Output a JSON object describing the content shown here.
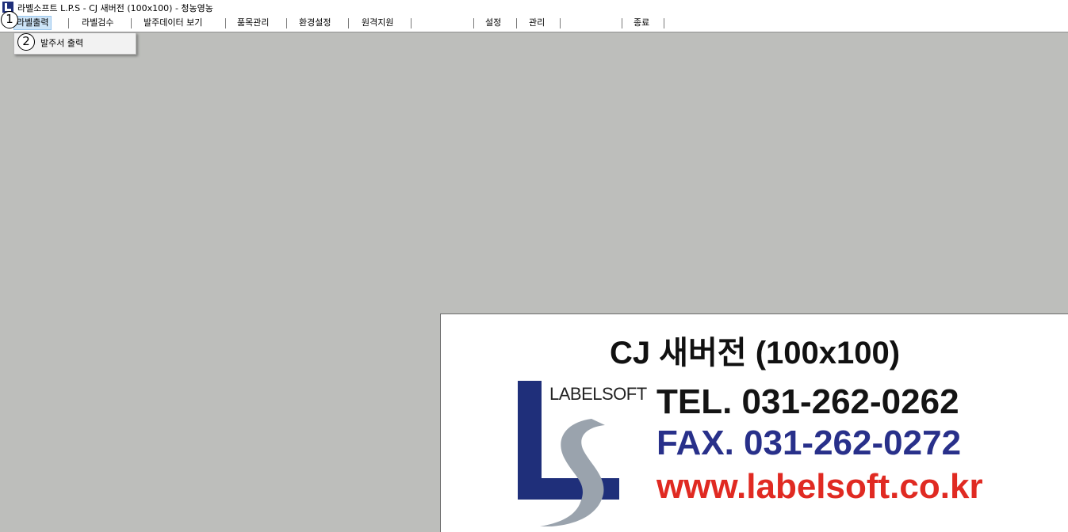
{
  "window": {
    "title": "라벨소프트 L.P.S - CJ 새버전 (100x100) - 청농영농"
  },
  "menu": {
    "items": [
      {
        "label": "라벨출력"
      },
      {
        "label": "라벨검수"
      },
      {
        "label": "발주데이터 보기"
      },
      {
        "label": "품목관리"
      },
      {
        "label": "환경설정"
      },
      {
        "label": "원격지원"
      },
      {
        "label": "설정"
      },
      {
        "label": "관리"
      },
      {
        "label": "종료"
      }
    ]
  },
  "dropdown": {
    "items": [
      {
        "label": "발주서 출력"
      }
    ]
  },
  "markers": {
    "step1": "1",
    "step2": "2"
  },
  "banner": {
    "title": "CJ 새버전 (100x100)",
    "logo_text": "LABELSOFT",
    "tel": "TEL. 031-262-0262",
    "fax": "FAX. 031-262-0272",
    "web": "www.labelsoft.co.kr"
  },
  "colors": {
    "workspace": "#bdbebb",
    "fax_text": "#28308a",
    "web_text": "#e02a22",
    "logo_blue": "#1f2f7a",
    "logo_gray": "#9aa3ad"
  }
}
